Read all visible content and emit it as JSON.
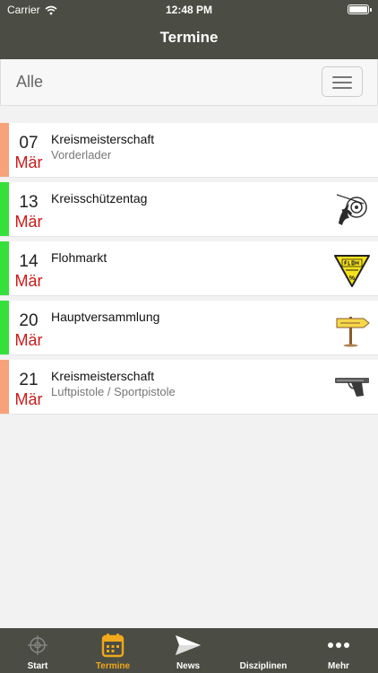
{
  "status_bar": {
    "carrier": "Carrier",
    "time": "12:48 PM"
  },
  "nav": {
    "title": "Termine"
  },
  "filter": {
    "selected": "Alle"
  },
  "events": [
    {
      "day": "07",
      "month": "Mär",
      "title": "Kreismeisterschaft",
      "subtitle": "Vorderlader",
      "color": "#f7a27a",
      "icon": ""
    },
    {
      "day": "13",
      "month": "Mär",
      "title": "Kreisschützentag",
      "subtitle": "",
      "color": "#36e03a",
      "icon": "shooting-target-icon"
    },
    {
      "day": "14",
      "month": "Mär",
      "title": "Flohmarkt",
      "subtitle": "",
      "color": "#36e03a",
      "icon": "flea-market-sign-icon"
    },
    {
      "day": "20",
      "month": "Mär",
      "title": "Hauptversammlung",
      "subtitle": "",
      "color": "#36e03a",
      "icon": "signpost-icon"
    },
    {
      "day": "21",
      "month": "Mär",
      "title": "Kreismeisterschaft",
      "subtitle": "Luftpistole / Sportpistole",
      "color": "#f7a27a",
      "icon": "pistol-icon"
    }
  ],
  "tabs": [
    {
      "label": "Start",
      "icon": "crosshair-icon",
      "active": false
    },
    {
      "label": "Termine",
      "icon": "calendar-icon",
      "active": true
    },
    {
      "label": "News",
      "icon": "paper-plane-icon",
      "active": false
    },
    {
      "label": "Disziplinen",
      "icon": "rifle-icon",
      "active": false
    },
    {
      "label": "Mehr",
      "icon": "more-dots-icon",
      "active": false
    }
  ],
  "colors": {
    "header_bg": "#4b4d44",
    "accent": "#f0a81c",
    "month_red": "#cc1a1a"
  }
}
